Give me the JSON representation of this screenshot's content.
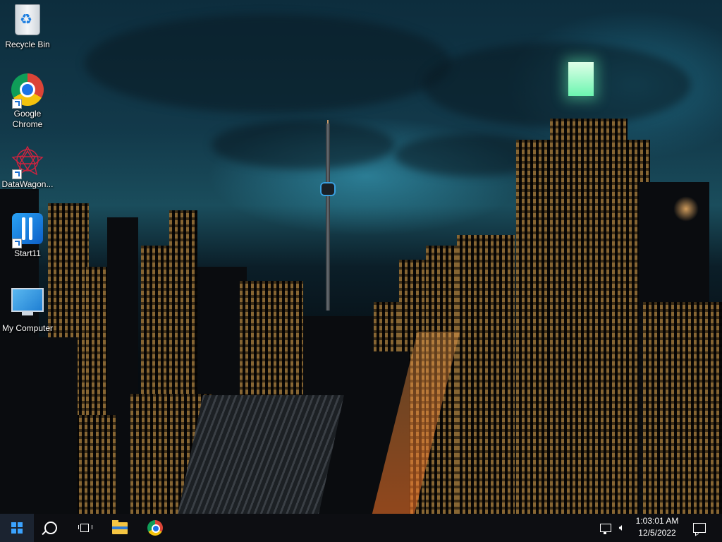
{
  "desktop": {
    "icons": [
      {
        "label": "Recycle Bin",
        "icon": "recycle-bin-icon"
      },
      {
        "label": "Google Chrome",
        "icon": "chrome-icon"
      },
      {
        "label": "DataWagon...",
        "icon": "datawagon-icon"
      },
      {
        "label": "Start11",
        "icon": "start11-icon"
      },
      {
        "label": "My Computer",
        "icon": "monitor-icon"
      }
    ]
  },
  "taskbar": {
    "start_icon": "windows-logo-icon",
    "search_icon": "search-icon",
    "taskview_icon": "task-view-icon",
    "pinned": [
      {
        "icon": "file-explorer-icon"
      },
      {
        "icon": "chrome-icon"
      }
    ],
    "tray": {
      "network_icon": "network-icon",
      "volume_icon": "volume-icon",
      "time": "1:03:01 AM",
      "date": "12/5/2022",
      "notifications_icon": "action-center-icon"
    }
  },
  "colors": {
    "taskbar_bg": "#0d0e12",
    "accent": "#3ba3ff"
  }
}
